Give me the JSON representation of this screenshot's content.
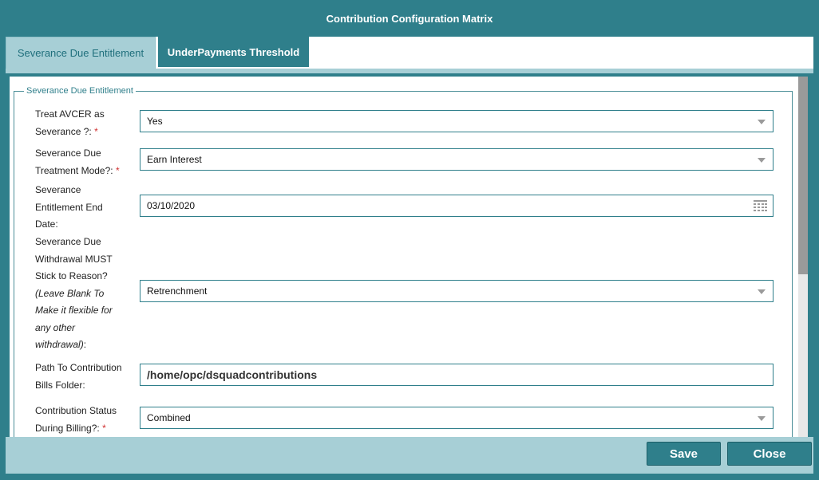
{
  "dialog": {
    "title": "Contribution Configuration Matrix"
  },
  "tabs": [
    {
      "label": "Severance Due Entitlement",
      "active": true
    },
    {
      "label": "UnderPayments Threshold",
      "active": false
    }
  ],
  "section": {
    "legend": "Severance Due Entitlement"
  },
  "form": {
    "treat_avcer": {
      "label_line1": "Treat AVCER as",
      "label_line2": "Severance ?:",
      "required": "*",
      "value": "Yes"
    },
    "treatment_mode": {
      "label_line1": "Severance Due",
      "label_line2": "Treatment Mode?:",
      "required": "*",
      "value": "Earn Interest"
    },
    "end_date": {
      "label_line1": "Severance",
      "label_line2": "Entitlement End",
      "label_line3": "Date:",
      "value": "03/10/2020"
    },
    "withdrawal_reason": {
      "label_line1": "Severance Due",
      "label_line2": "Withdrawal MUST",
      "label_line3": "Stick to Reason?",
      "label_italic1": "(Leave Blank To",
      "label_italic2": "Make it flexible for",
      "label_italic3": "any other",
      "label_italic4": "withdrawal)",
      "label_tail": ":",
      "value": "Retrenchment"
    },
    "bills_path": {
      "label_line1": "Path To Contribution",
      "label_line2": "Bills Folder:",
      "value": "/home/opc/dsquadcontributions"
    },
    "billing_status": {
      "label_line1": "Contribution Status",
      "label_line2": "During Billing?:",
      "required": "*",
      "value": "Combined"
    }
  },
  "footer": {
    "save_label": "Save",
    "close_label": "Close"
  },
  "colors": {
    "primary": "#2f7f8b",
    "tab_active_bg": "#a7cfd6",
    "required": "#d03030"
  }
}
